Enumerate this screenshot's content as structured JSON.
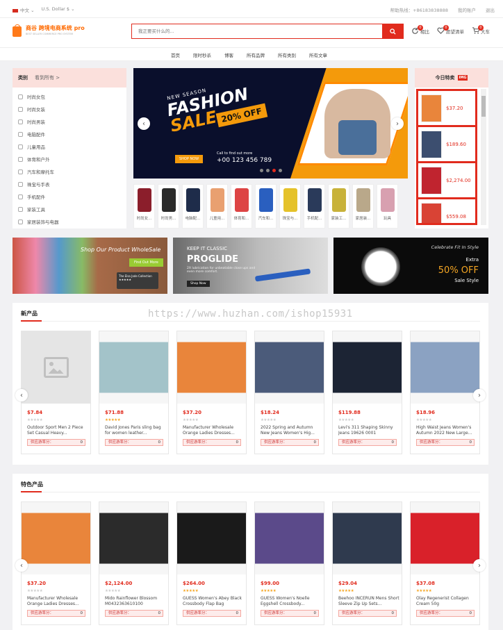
{
  "topbar": {
    "lang": "中文",
    "currency": "U.S. Dollar $",
    "hotline": "帮助热线：+86183838888",
    "account": "我的账户",
    "logout": "退出"
  },
  "logo": {
    "name": "商谷  跨境电商系统  pro",
    "tagline": "BEST SELLER COMMERCE PRO SYSTEM"
  },
  "search": {
    "placeholder": "我正要买什么的...",
    "button_icon": "search-icon"
  },
  "header_icons": [
    {
      "label": "相比",
      "badge": "0",
      "icon": "refresh-icon"
    },
    {
      "label": "愿望清单",
      "badge": "0",
      "icon": "heart-icon"
    },
    {
      "label": "大车",
      "badge": "0",
      "icon": "cart-icon"
    }
  ],
  "nav": [
    "首页",
    "限时秒杀",
    "博客",
    "所有品牌",
    "所有类别",
    "所有文章"
  ],
  "categories": {
    "title": "类别",
    "view_all": "看到所有 >",
    "items": [
      "时尚女包",
      "时尚女装",
      "时尚男装",
      "电脑配件",
      "儿童用品",
      "体育和户外",
      "汽车和摩托车",
      "珠宝与手表",
      "手机配件",
      "家装工具",
      "家居装饰与电器"
    ]
  },
  "banner": {
    "new_season": "NEW SEASON",
    "line1": "FASHION",
    "line2": "SALE",
    "offer": "20% OFF",
    "shop_now": "SHOP NOW",
    "call": "Call to find out more",
    "phone": "+00 123 456 789"
  },
  "mini_categories": [
    "时尚女...",
    "时尚男...",
    "电脑配...",
    "儿童用...",
    "体育和...",
    "汽车和...",
    "珠宝与...",
    "手机配...",
    "家装工...",
    "家居装...",
    "玩具"
  ],
  "today_special": {
    "title": "今日特卖",
    "tag": "IMG",
    "items": [
      {
        "price": "$37.20",
        "color": "#e9853b"
      },
      {
        "price": "$189.60",
        "color": "#3c4e6f"
      },
      {
        "price": "$2,274.00",
        "color": "#c0242f"
      },
      {
        "price": "$559.08",
        "color": "#d94335"
      }
    ]
  },
  "ads": {
    "ad1": {
      "title": "Shop Our Product WholeSale",
      "button": "Find Out More",
      "card": "The Elsa Jade Collection ★★★★★"
    },
    "ad2": {
      "keep": "KEEP IT CLASSIC",
      "title": "PROGLIDE",
      "desc": "2X lubrication for unbeatable close ups and even more comfort.",
      "shop": "Shop Now"
    },
    "ad3": {
      "celebrate": "Celebrate Fit In Style",
      "extra": "Extra",
      "percent": "50% OFF",
      "sale": "Sale Style"
    }
  },
  "watermark": "https://www.huzhan.com/ishop15931",
  "new_products": {
    "title": "新产品",
    "stock_label": "供应游率分：",
    "items": [
      {
        "price": "$7.84",
        "name": "Outdoor Sport Men 2 Piece Set Casual Heavy...",
        "stars": "★★★★★",
        "rated": false,
        "stock": "0",
        "color": "#e5e5e5"
      },
      {
        "price": "$71.88",
        "name": "David Jones Paris sling bag for women leather...",
        "stars": "★★★★★",
        "rated": true,
        "stock": "0",
        "color": "#a3c3c9"
      },
      {
        "price": "$37.20",
        "name": "Manufacturer Wholesale Orange Ladies Dresses...",
        "stars": "★★★★★",
        "rated": false,
        "stock": "0",
        "color": "#e9853b"
      },
      {
        "price": "$18.24",
        "name": "2022 Spring and Autumn New Jeans Women's Hig...",
        "stars": "★★★★★",
        "rated": false,
        "stock": "0",
        "color": "#4b5b7a"
      },
      {
        "price": "$119.88",
        "name": "Levi's 311 Shaping Skinny Jeans 19626 0001",
        "stars": "★★★★★",
        "rated": false,
        "stock": "0",
        "color": "#1c2434"
      },
      {
        "price": "$18.96",
        "name": "High Waist Jeans Women's Autumn 2022 New Large...",
        "stars": "★★★★★",
        "rated": false,
        "stock": "0",
        "color": "#8ba2c2"
      }
    ]
  },
  "featured_products": {
    "title": "特色产品",
    "stock_label": "供应游率分：",
    "items": [
      {
        "price": "$37.20",
        "name": "Manufacturer Wholesale Orange Ladies Dresses...",
        "stars": "★★★★★",
        "rated": false,
        "stock": "0",
        "color": "#e9853b"
      },
      {
        "price": "$2,124.00",
        "name": "Mido Rainflower Blossom M0432363610100",
        "stars": "★★★★★",
        "rated": false,
        "stock": "0",
        "color": "#2b2b2b"
      },
      {
        "price": "$264.00",
        "name": "GUESS Women's Abey Black Crossbody Flap Bag",
        "stars": "★★★★★",
        "rated": true,
        "stock": "0",
        "color": "#1a1a1a"
      },
      {
        "price": "$99.00",
        "name": "GUESS Women's Noelle Eggshell Crossbody...",
        "stars": "★★★★★",
        "rated": true,
        "stock": "0",
        "color": "#5b4a8a"
      },
      {
        "price": "$29.04",
        "name": "Beehoo INCERUN Mens Short Sleeve Zip Up Sets...",
        "stars": "★★★★★",
        "rated": true,
        "stock": "0",
        "color": "#2f3a4e"
      },
      {
        "price": "$37.08",
        "name": "Olay Regenerist Collagen Cream 50g",
        "stars": "★★★★★",
        "rated": true,
        "stock": "0",
        "color": "#d9212a"
      }
    ]
  }
}
